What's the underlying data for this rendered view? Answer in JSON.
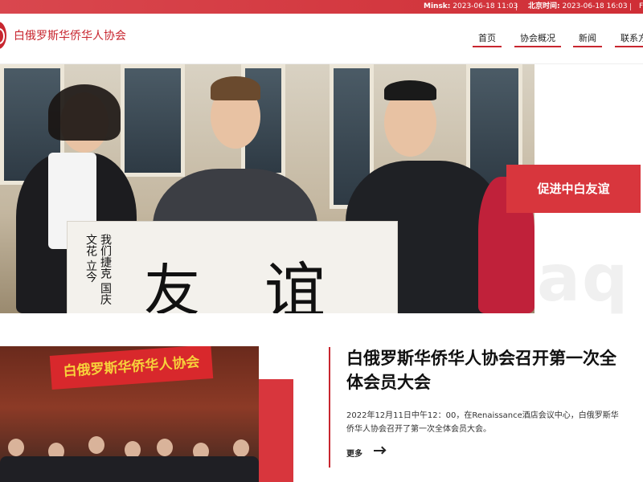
{
  "topbar": {
    "minsk_label": "Minsk:",
    "minsk_time": "2023-06-18 11:03",
    "beijing_label": "北京时间:",
    "beijing_time": "2023-06-18 16:03",
    "more_label": "F"
  },
  "header": {
    "site_name": "白俄罗斯华侨华人协会",
    "nav": [
      "首页",
      "协会概况",
      "新闻",
      "联系方"
    ]
  },
  "hero": {
    "badge": "促进中白友谊",
    "watermark": "aq"
  },
  "news": {
    "banner_text": "白俄罗斯华侨华人协会",
    "title": "白俄罗斯华侨华人协会召开第一次全体会员大会",
    "summary": "2022年12月11日中午12：00，在Renaissance酒店会议中心，白俄罗斯华侨华人协会召开了第一次全体会员大会。",
    "more": "更多"
  },
  "colors": {
    "accent": "#c8262f",
    "topbar": "#d9474e"
  }
}
